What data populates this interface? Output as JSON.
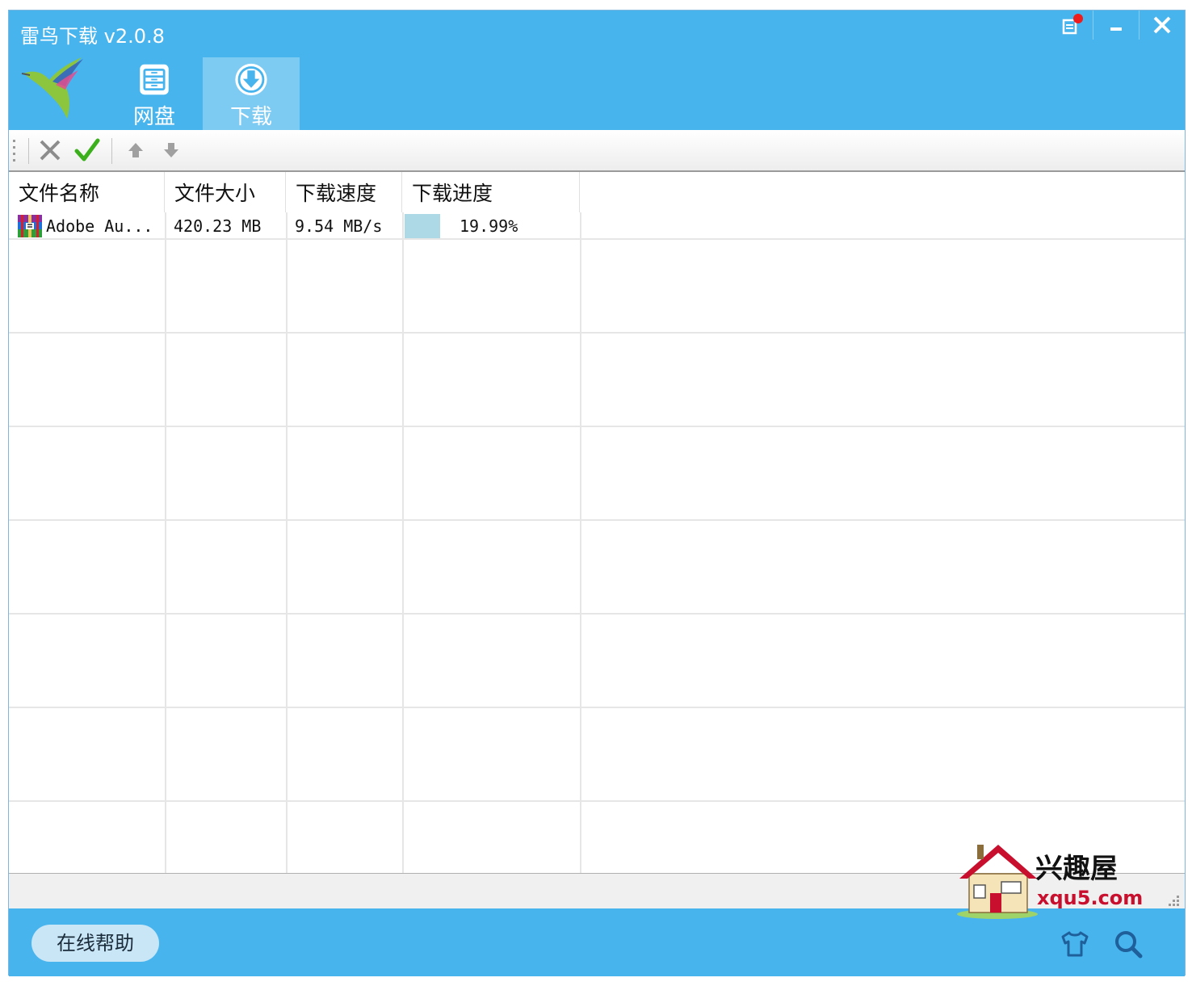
{
  "window": {
    "title": "雷鸟下载 v2.0.8"
  },
  "titlebar_buttons": [
    {
      "name": "skin-notification",
      "icon": "notification-icon"
    },
    {
      "name": "minimize",
      "icon": "minimize-icon"
    },
    {
      "name": "close",
      "icon": "close-icon"
    }
  ],
  "nav": {
    "tabs": [
      {
        "label": "网盘",
        "icon": "cloud-drive-icon",
        "active": false
      },
      {
        "label": "下载",
        "icon": "download-icon",
        "active": true
      }
    ]
  },
  "toolbar": {
    "icons": [
      "delete-icon",
      "confirm-icon",
      "move-up-icon",
      "move-down-icon"
    ]
  },
  "table": {
    "columns": [
      "文件名称",
      "文件大小",
      "下载速度",
      "下载进度"
    ],
    "rows": [
      {
        "name": "Adobe Au...",
        "size": "420.23 MB",
        "speed": "9.54 MB/s",
        "progress_text": "19.99%",
        "progress": 0.1999,
        "icon": "winrar-archive-icon"
      }
    ]
  },
  "footer": {
    "help_label": "在线帮助",
    "icons": [
      "skin-icon",
      "search-icon"
    ]
  },
  "watermark": {
    "line1": "兴趣屋",
    "line2": "xqu5.com"
  },
  "colors": {
    "accent": "#48b4ee",
    "active_tab": "#7dcaf3",
    "progress_fill": "#add8e6",
    "help_button": "#c8e6f6"
  }
}
